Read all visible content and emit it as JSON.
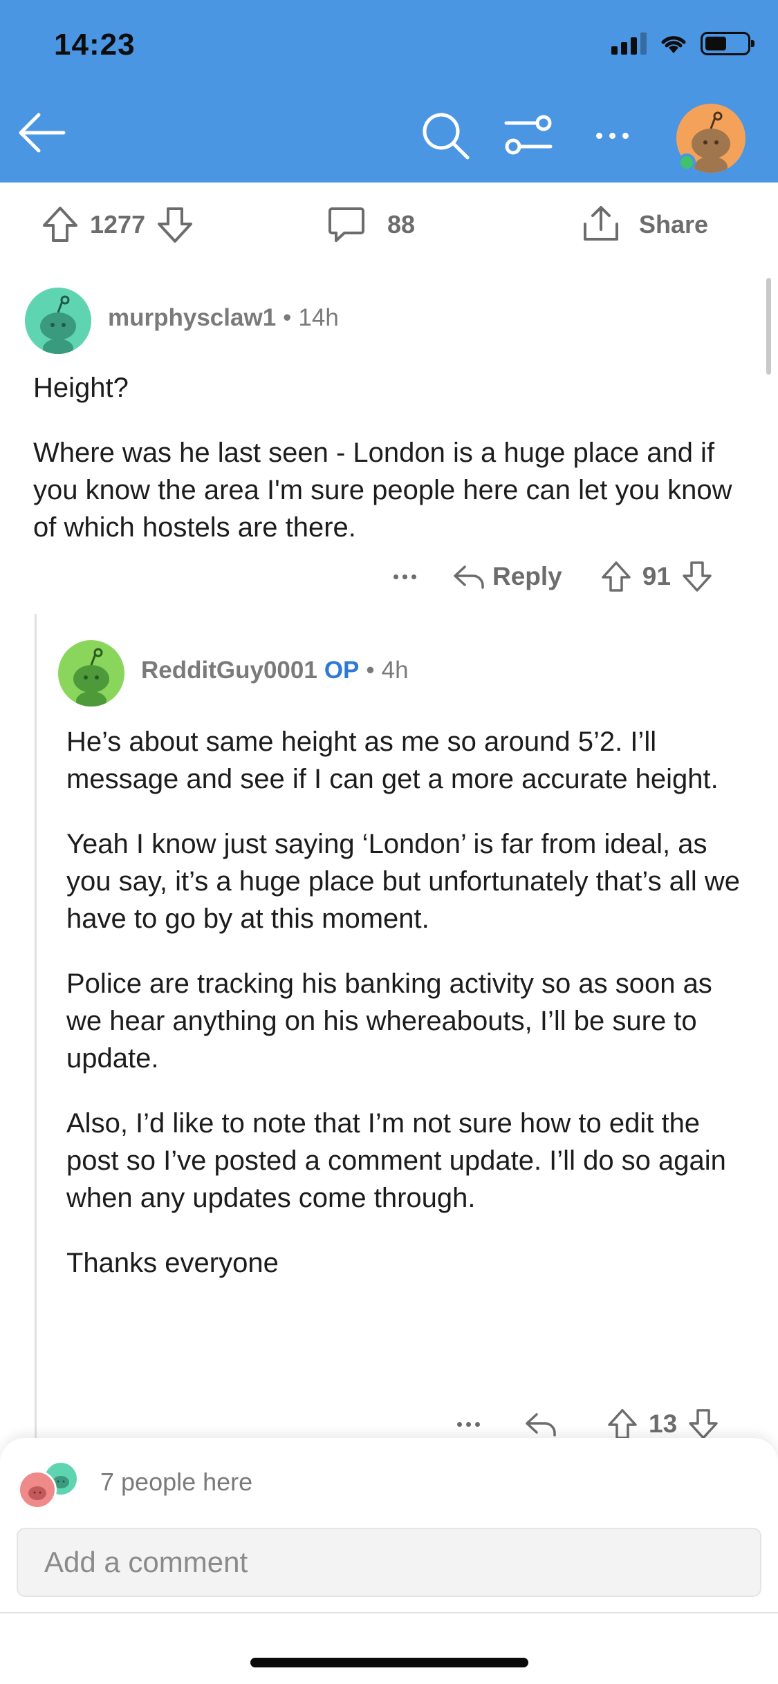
{
  "status_bar": {
    "time": "14:23"
  },
  "colors": {
    "header": "#4a96e3",
    "op": "#2d79d6",
    "online": "#3fc26b"
  },
  "post_actions": {
    "upvotes": "1277",
    "comments": "88",
    "share_label": "Share"
  },
  "comments": [
    {
      "user": "murphysclaw1",
      "time": "14h",
      "paragraphs": [
        "Height?",
        "Where was he last seen - London is a huge place and if you know the area I'm sure people here can let you know of which hostels are there."
      ],
      "reply_label": "Reply",
      "votes": "91"
    },
    {
      "user": "RedditGuy0001",
      "op_badge": "OP",
      "time": "4h",
      "paragraphs": [
        "He’s about same height as me so around 5’2. I’ll message and see if I can get a more accurate height.",
        "Yeah I know just saying ‘London’ is far from ideal, as you say, it’s a huge place but unfortunately that’s all we have to go by at this moment.",
        "Police are tracking his banking activity so as soon as we hear anything on his whereabouts, I’ll be sure to update.",
        "Also, I’d like to note that I’m not sure how to edit the post so I’ve posted a comment update. I’ll do so again when any updates come through.",
        "Thanks everyone"
      ],
      "votes": "13"
    }
  ],
  "bottom": {
    "people_here": "7 people here",
    "comment_placeholder": "Add a comment"
  }
}
